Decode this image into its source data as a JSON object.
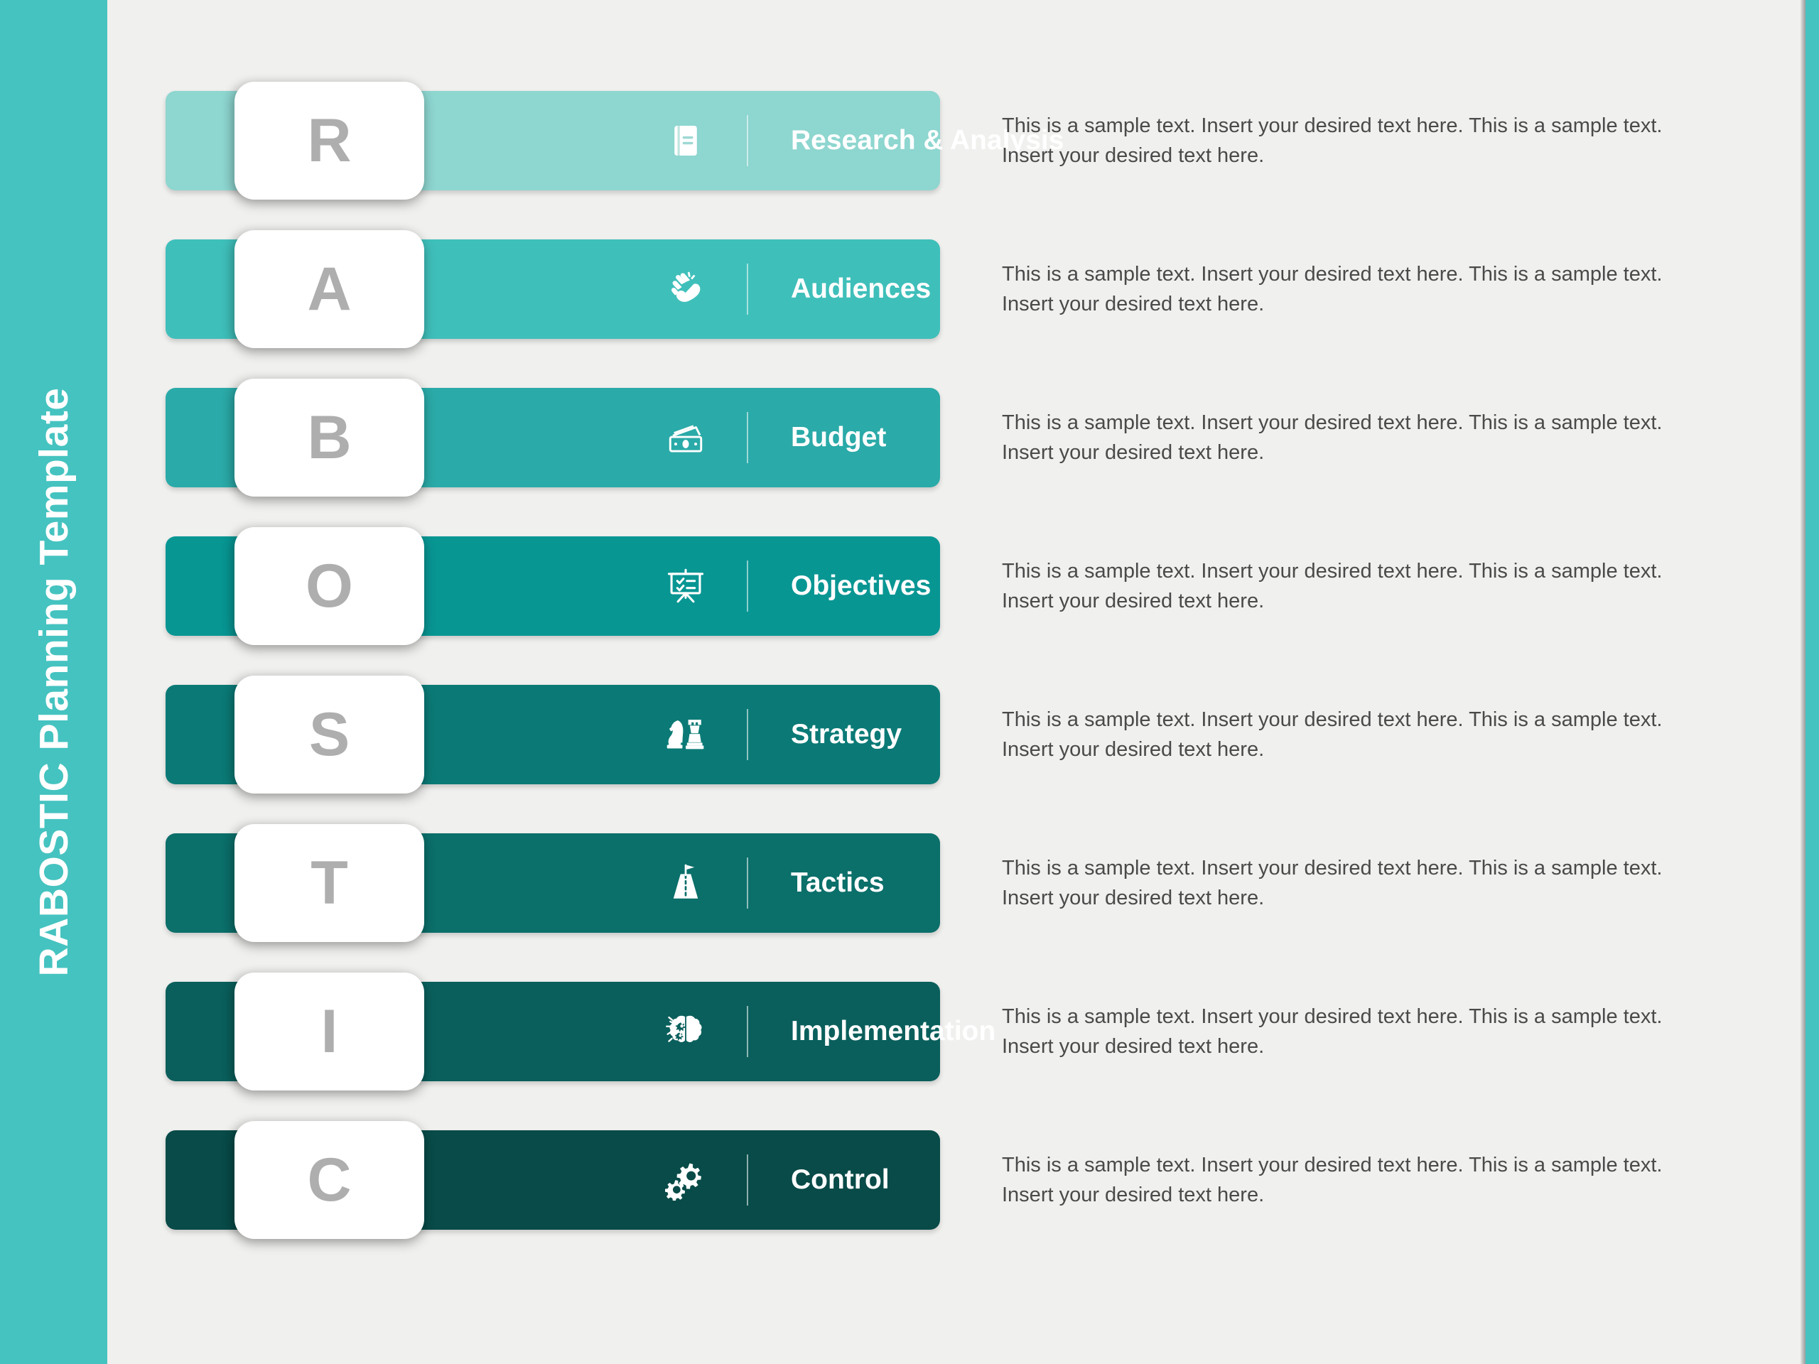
{
  "sidebar": {
    "title": "RABOSTIC Planning Template",
    "background_color": "#45c3c0"
  },
  "page": {
    "background_color": "#f0f0ee",
    "accent_color": "#45c3c0",
    "letter_color": "#aeaeae",
    "label_color": "#ffffff",
    "body_text_color": "#4a4a4a"
  },
  "rows": [
    {
      "letter": "R",
      "label": "Research & Analysis",
      "icon": "book-icon",
      "bar_color": "#8ed6d0",
      "body": "This is a sample text. Insert your desired text here. This is a sample text. Insert your desired text here."
    },
    {
      "letter": "A",
      "label": "Audiences",
      "icon": "clapping-hands-icon",
      "bar_color": "#3fbfba",
      "body": "This is a sample text. Insert your desired text here. This is a sample text. Insert your desired text here."
    },
    {
      "letter": "B",
      "label": "Budget",
      "icon": "money-icon",
      "bar_color": "#2aaaa8",
      "body": "This is a sample text. Insert your desired text here. This is a sample text. Insert your desired text here."
    },
    {
      "letter": "O",
      "label": "Objectives",
      "icon": "presentation-board-icon",
      "bar_color": "#089693",
      "body": "This is a sample text. Insert your desired text here. This is a sample text. Insert your desired text here."
    },
    {
      "letter": "S",
      "label": "Strategy",
      "icon": "chess-pieces-icon",
      "bar_color": "#0b7a76",
      "body": "This is a sample text. Insert your desired text here. This is a sample text. Insert your desired text here."
    },
    {
      "letter": "T",
      "label": "Tactics",
      "icon": "road-flag-icon",
      "bar_color": "#0b6f6a",
      "body": "This is a sample text. Insert your desired text here. This is a sample text. Insert your desired text here."
    },
    {
      "letter": "I",
      "label": "Implementation",
      "icon": "brain-gears-icon",
      "bar_color": "#0a5f5c",
      "body": "This is a sample text. Insert your desired text here. This is a sample text. Insert your desired text here."
    },
    {
      "letter": "C",
      "label": "Control",
      "icon": "gears-icon",
      "bar_color": "#084b48",
      "body": "This is a sample text. Insert your desired text here. This is a sample text. Insert your desired text here."
    }
  ]
}
